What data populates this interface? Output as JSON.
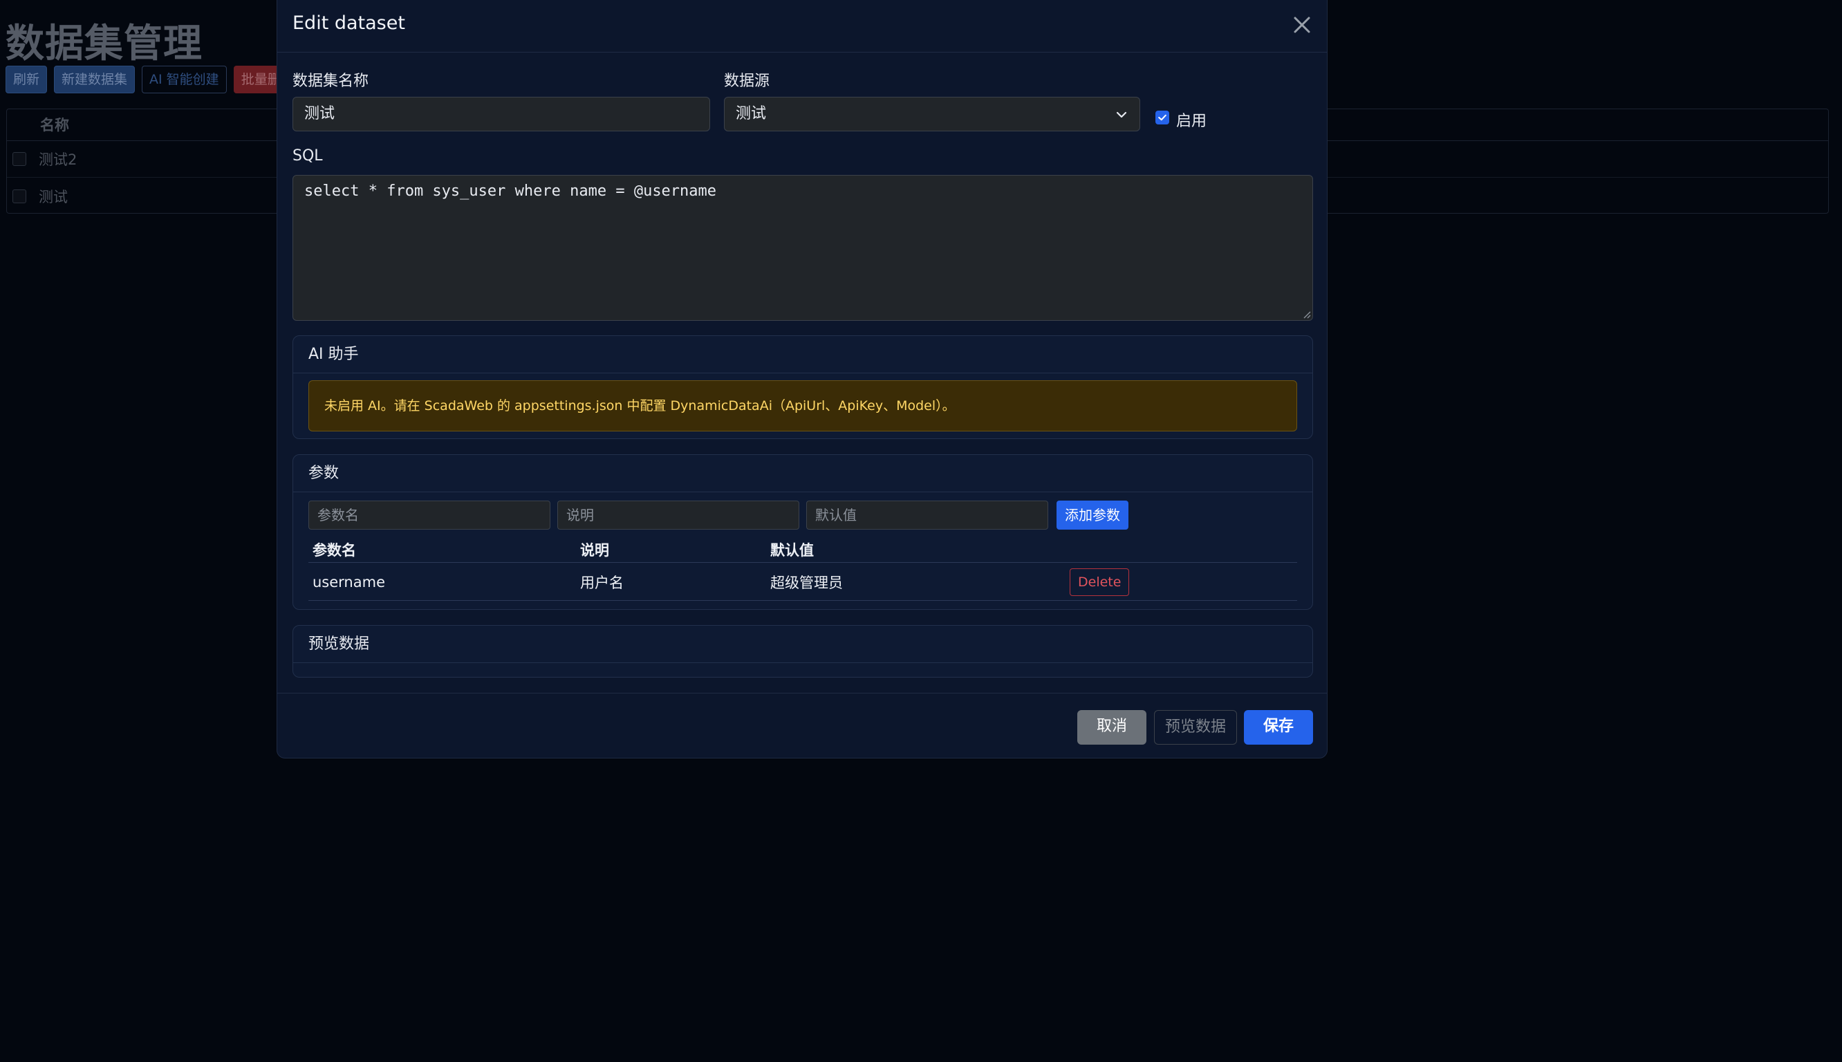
{
  "background": {
    "title": "数据集管理",
    "toolbar": {
      "refresh": "刷新",
      "new_dataset": "新建数据集",
      "ai_create": "AI 智能创建",
      "batch": "批量删"
    },
    "table": {
      "header_name": "名称",
      "rows": [
        {
          "name": "测试2"
        },
        {
          "name": "测试"
        }
      ]
    }
  },
  "modal": {
    "title": "Edit dataset",
    "form": {
      "name_label": "数据集名称",
      "name_value": "测试",
      "source_label": "数据源",
      "source_value": "测试",
      "enabled_label": "启用",
      "enabled": true,
      "sql_label": "SQL",
      "sql_value": "select * from sys_user where name = @username"
    },
    "ai_card": {
      "title": "AI 助手",
      "notice": "未启用 AI。请在 ScadaWeb 的 appsettings.json 中配置 DynamicDataAi（ApiUrl、ApiKey、Model）。"
    },
    "params_card": {
      "title": "参数",
      "name_placeholder": "参数名",
      "desc_placeholder": "说明",
      "default_placeholder": "默认值",
      "add_label": "添加参数",
      "columns": [
        "参数名",
        "说明",
        "默认值"
      ],
      "rows": [
        {
          "name": "username",
          "desc": "用户名",
          "default": "超级管理员",
          "delete_label": "Delete"
        }
      ]
    },
    "preview_card": {
      "title": "预览数据"
    },
    "footer": {
      "cancel": "取消",
      "preview": "预览数据",
      "save": "保存"
    }
  },
  "colors": {
    "primary": "#2563eb",
    "danger": "#dc3545",
    "warning_text": "#ffd766",
    "modal_bg": "#0c162c"
  }
}
